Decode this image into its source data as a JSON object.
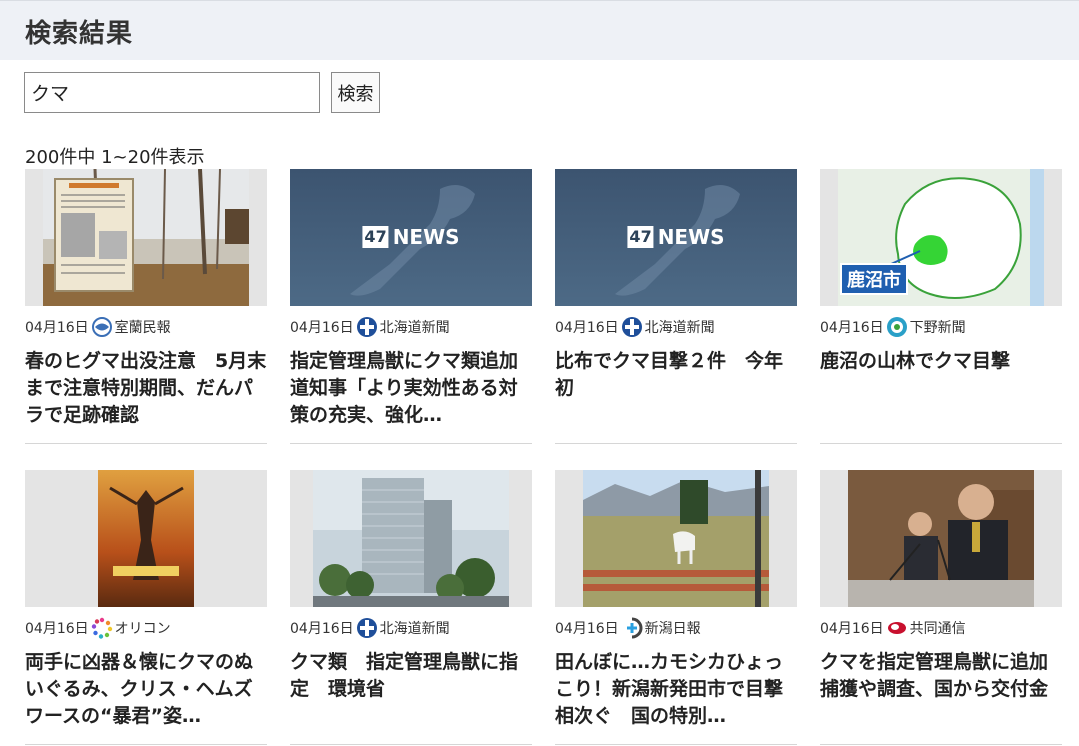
{
  "header": {
    "title": "検索結果"
  },
  "search": {
    "value": "クマ",
    "button_label": "検索"
  },
  "results": {
    "count_text": "200件中 1~20件表示",
    "articles": [
      {
        "date": "04月16日",
        "source": "室蘭民報",
        "source_icon": "muroran-minpo-logo-icon",
        "title": "春のヒグマ出没注意　5月末まで注意特別期間、だんパラで足跡確認"
      },
      {
        "date": "04月16日",
        "source": "北海道新聞",
        "source_icon": "hokkaido-shimbun-logo-icon",
        "title": "指定管理鳥獣にクマ類追加　道知事「より実効性ある対策の充実、強化…",
        "image_text": {
          "badge": "47",
          "word": "NEWS"
        }
      },
      {
        "date": "04月16日",
        "source": "北海道新聞",
        "source_icon": "hokkaido-shimbun-logo-icon",
        "title": "比布でクマ目撃２件　今年初",
        "image_text": {
          "badge": "47",
          "word": "NEWS"
        }
      },
      {
        "date": "04月16日",
        "source": "下野新聞",
        "source_icon": "shimotsuke-shimbun-logo-icon",
        "title": "鹿沼の山林でクマ目撃",
        "image_text": {
          "map_label": "鹿沼市"
        }
      },
      {
        "date": "04月16日",
        "source": "オリコン",
        "source_icon": "oricon-logo-icon",
        "title": "両手に凶器＆懐にクマのぬいぐるみ、クリス・ヘムズワースの“暴君”姿…"
      },
      {
        "date": "04月16日",
        "source": "北海道新聞",
        "source_icon": "hokkaido-shimbun-logo-icon",
        "title": "クマ類　指定管理鳥獣に指定　環境省"
      },
      {
        "date": "04月16日",
        "source": "新潟日報",
        "source_icon": "niigata-nippo-logo-icon",
        "title": "田んぼに…カモシカひょっこり！新潟新発田市で目撃相次ぐ　国の特別…"
      },
      {
        "date": "04月16日",
        "source": "共同通信",
        "source_icon": "kyodo-news-logo-icon",
        "title": "クマを指定管理鳥獣に追加　捕獲や調査、国から交付金"
      }
    ]
  },
  "colors": {
    "header_bg": "#eef1f6",
    "divider": "#d6d6d6",
    "text": "#222222"
  }
}
